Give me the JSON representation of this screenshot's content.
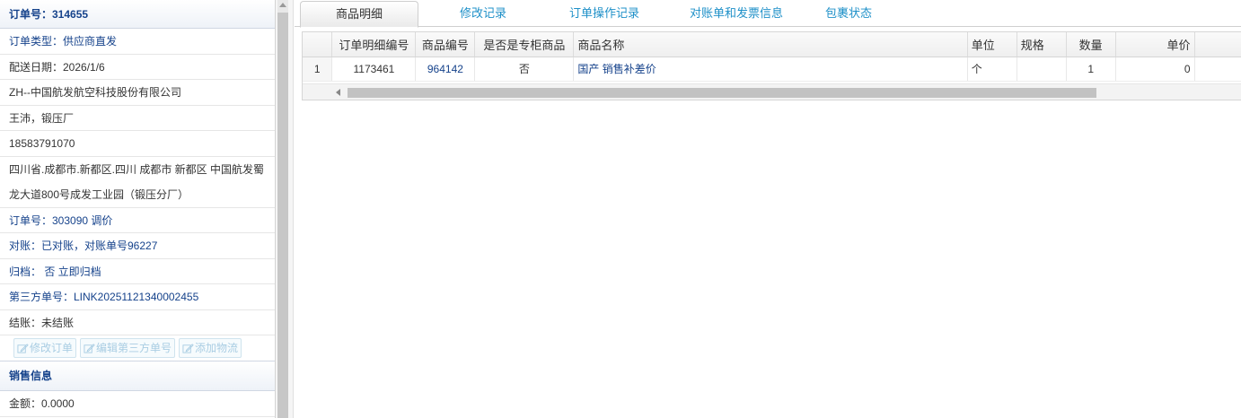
{
  "order": {
    "header": "订单号：314655",
    "fields": [
      {
        "text": "订单类型：供应商直发",
        "style": "blue"
      },
      {
        "text": "配送日期：2026/1/6",
        "style": "dark"
      },
      {
        "text": "ZH--中国航发航空科技股份有限公司",
        "style": "dark"
      },
      {
        "text": "王沛，锻压厂",
        "style": "dark"
      },
      {
        "text": "18583791070",
        "style": "dark"
      }
    ],
    "address": "四川省.成都市.新都区.四川 成都市 新都区 中国航发蜀龙大道800号成发工业园（锻压分厂）",
    "fields2": [
      {
        "text": "订单号：303090 调价",
        "style": "blue"
      },
      {
        "text": "对账：已对账，对账单号96227",
        "style": "blue"
      },
      {
        "text": "归档： 否 立即归档",
        "style": "blue"
      },
      {
        "text": "第三方单号：LINK20251121340002455",
        "style": "blue"
      },
      {
        "text": "结账：未结账",
        "style": "dark"
      }
    ],
    "buttons": {
      "edit_order": "修改订单",
      "edit_third": "编辑第三方单号",
      "add_logistics": "添加物流"
    }
  },
  "sales": {
    "header": "销售信息",
    "amount": "金额：0.0000"
  },
  "tabs": [
    "商品明细",
    "修改记录",
    "订单操作记录",
    "对账单和发票信息",
    "包裹状态"
  ],
  "grid": {
    "columns": [
      "",
      "订单明细编号",
      "商品编号",
      "是否是专柜商品",
      "商品名称",
      "单位",
      "规格",
      "数量",
      "单价"
    ],
    "rows": [
      {
        "num": "1",
        "detail_id": "1173461",
        "product_id": "964142",
        "is_counter": "否",
        "name": "国产 销售补差价",
        "unit": "个",
        "spec": "",
        "qty": "1",
        "price": "0"
      }
    ]
  },
  "colors": {
    "accent": "#15428b",
    "tab_link": "#1e90c8",
    "disabled_button": "#a9cde3"
  }
}
